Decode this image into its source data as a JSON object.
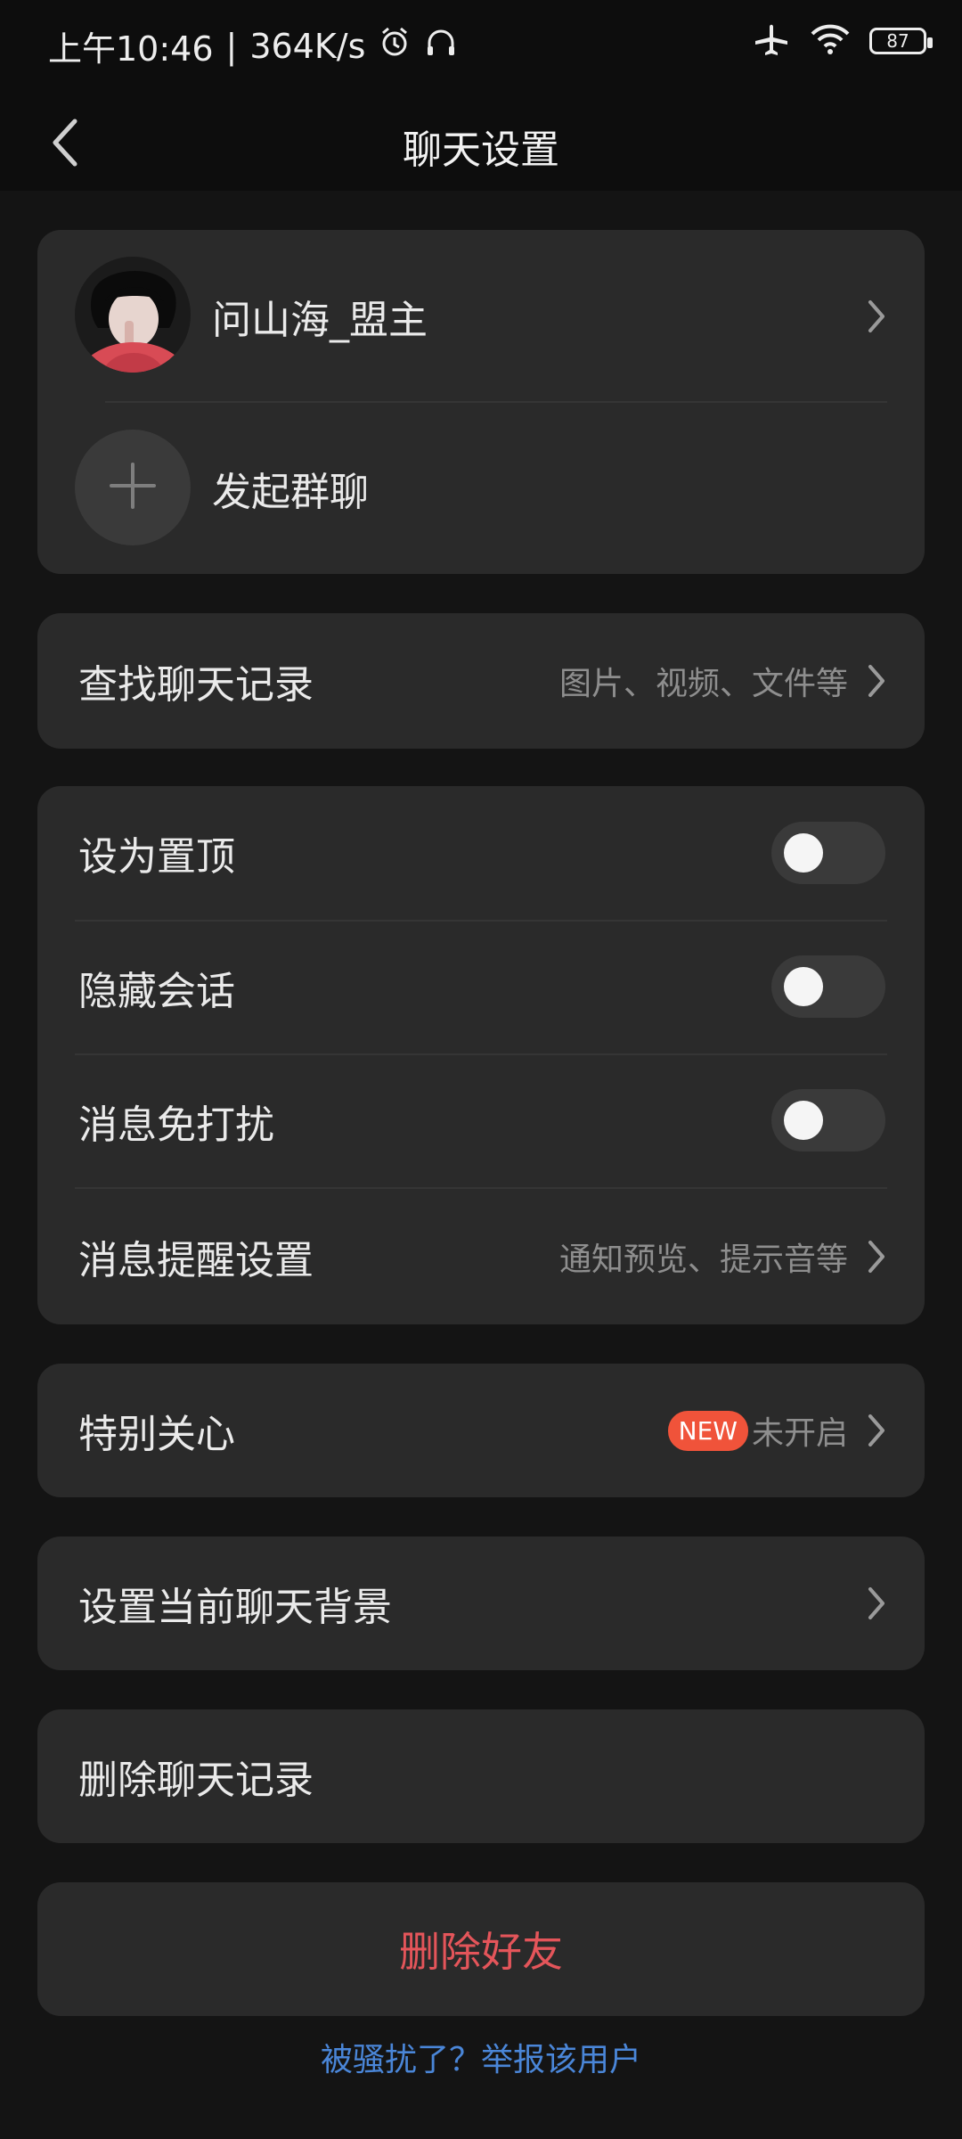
{
  "status_bar": {
    "time": "上午10:46",
    "separator": "|",
    "speed": "364K/s",
    "icons": [
      "alarm-icon",
      "headset-icon",
      "airplane-icon",
      "wifi-icon"
    ],
    "battery": "87"
  },
  "header": {
    "title": "聊天设置"
  },
  "contact": {
    "name": "问山海_盟主",
    "group_label": "发起群聊"
  },
  "search": {
    "label": "查找聊天记录",
    "hint": "图片、视频、文件等"
  },
  "settings": {
    "pin": "设为置顶",
    "hide": "隐藏会话",
    "mute": "消息免打扰",
    "notify": "消息提醒设置",
    "notify_hint": "通知预览、提示音等"
  },
  "special": {
    "label": "特别关心",
    "badge": "NEW",
    "status": "未开启"
  },
  "background": {
    "label": "设置当前聊天背景"
  },
  "delete_history": {
    "label": "删除聊天记录"
  },
  "delete_friend": {
    "label": "删除好友"
  },
  "report": {
    "label": "被骚扰了？举报该用户"
  },
  "colors": {
    "background": "#141414",
    "card": "#2a2a2a",
    "danger": "#E4555A",
    "link": "#4A86D8",
    "badge": "#F0533A"
  }
}
